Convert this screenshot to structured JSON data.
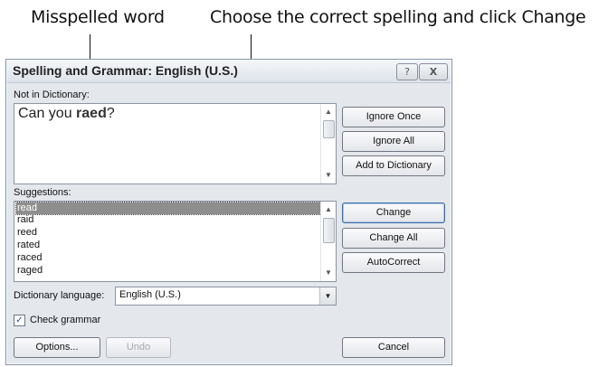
{
  "callouts": {
    "left": "Misspelled word",
    "right": "Choose the correct spelling and click Change"
  },
  "dialog": {
    "title": "Spelling and Grammar: English (U.S.)",
    "help_label": "?",
    "close_label": "X",
    "not_in_dictionary": {
      "label": "Not in Dictionary:",
      "text_before": "Can you ",
      "misspelled": "raed",
      "text_after": "?"
    },
    "suggestions_label": "Suggestions:",
    "suggestions": [
      "read",
      "raid",
      "reed",
      "rated",
      "raced",
      "raged"
    ],
    "selected_suggestion": "read",
    "buttons": {
      "ignore_once": "Ignore Once",
      "ignore_all": "Ignore All",
      "add_to_dictionary": "Add to Dictionary",
      "change": "Change",
      "change_all": "Change All",
      "autocorrect": "AutoCorrect",
      "options": "Options...",
      "undo": "Undo",
      "cancel": "Cancel"
    },
    "dictionary_language": {
      "label": "Dictionary language:",
      "value": "English (U.S.)"
    },
    "check_grammar": {
      "label": "Check grammar",
      "checked": true
    }
  }
}
